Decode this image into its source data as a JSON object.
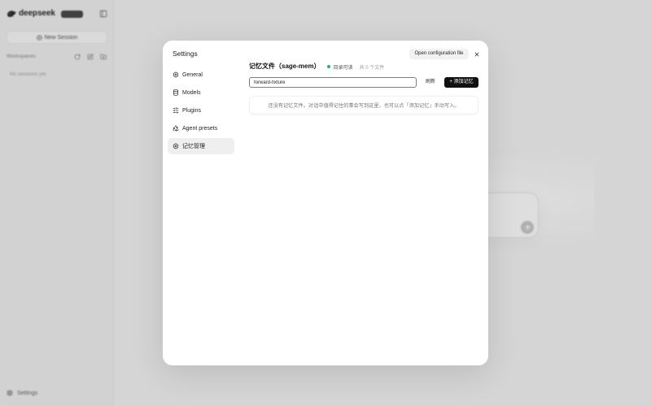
{
  "app": {
    "brand": "deepseek",
    "new_session_label": "New Session",
    "workspaces_label": "Workspaces",
    "empty_sessions": "No sessions yet",
    "settings_label": "Settings",
    "icons": {
      "logo": "deepseek-whale-icon",
      "sidebar_toggle": "sidebar-panel-icon",
      "new_session": "plus-circle-icon",
      "workspace_actions": [
        "refresh-icon",
        "square-pen-icon",
        "folder-plus-icon"
      ],
      "settings": "gear-icon",
      "send": "arrow-up-icon"
    }
  },
  "modal": {
    "title": "Settings",
    "open_config_label": "Open configuration file",
    "close_icon": "close-icon",
    "nav": [
      {
        "label": "General",
        "icon": "hexagon-settings-icon",
        "selected": false
      },
      {
        "label": "Models",
        "icon": "database-icon",
        "selected": false
      },
      {
        "label": "Plugins",
        "icon": "sliders-icon",
        "selected": false
      },
      {
        "label": "Agent presets",
        "icon": "recycle-icon",
        "selected": false
      },
      {
        "label": "记忆管理",
        "icon": "hexagon-settings-icon",
        "selected": true
      }
    ],
    "memory": {
      "heading": "记忆文件（sage-mem）",
      "status_text": "目录可读",
      "file_count": "共 0 个文件",
      "filter_value": "forward-fixture",
      "refresh_label": "刷新",
      "add_label": "+ 添加记忆",
      "empty_message": "还没有记忆文件。对话中值得记住的事会写到这里，也可以点「添加记忆」手动写入。"
    }
  },
  "colors": {
    "accent": "#111111",
    "status": "#22b573",
    "nav-selected": "#efefef"
  }
}
